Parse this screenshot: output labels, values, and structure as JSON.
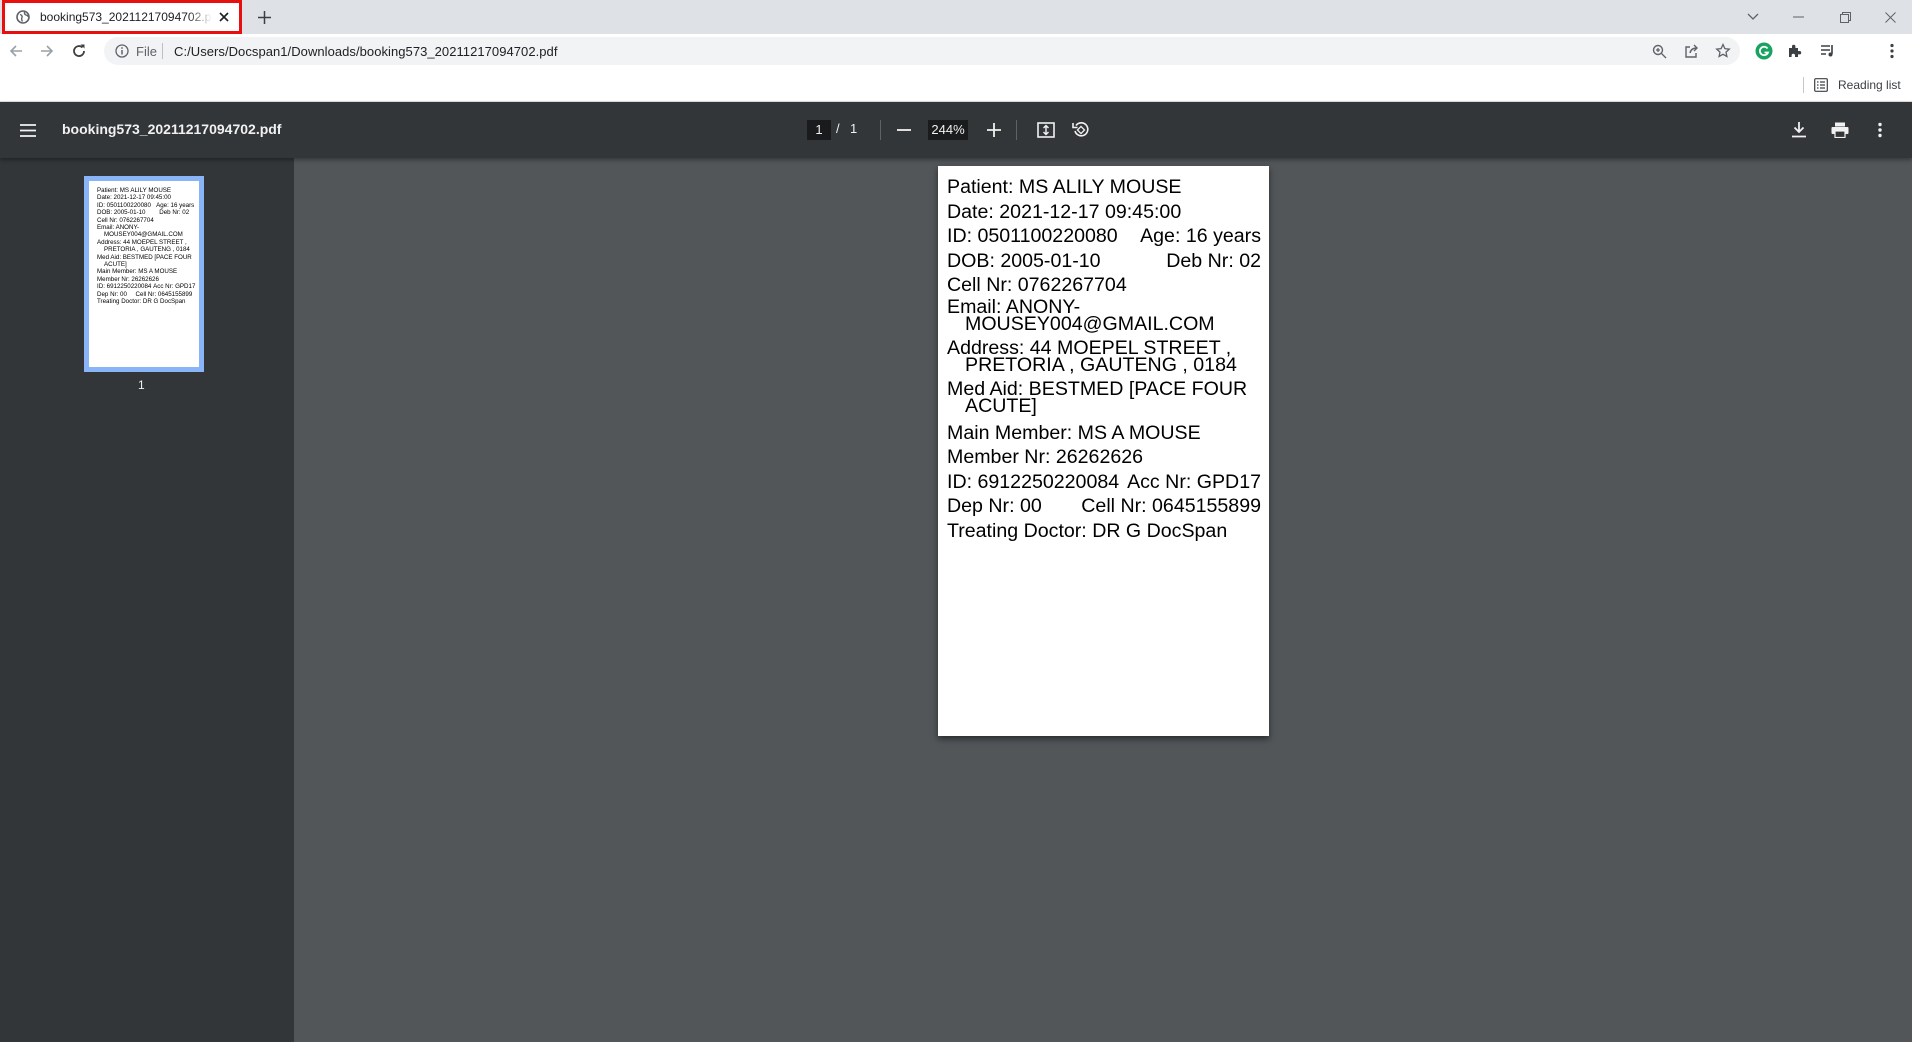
{
  "browser": {
    "tab_title": "booking573_20211217094702.pdf",
    "url_scheme": "File",
    "url": "C:/Users/Docspan1/Downloads/booking573_20211217094702.pdf",
    "reading_list_label": "Reading list",
    "extension_badge_color": "#1aa260",
    "tab_highlight_color": "#e8100f"
  },
  "pdf": {
    "file_name": "booking573_20211217094702.pdf",
    "current_page": "1",
    "page_separator": "/",
    "total_pages": "1",
    "zoom": "244%",
    "thumbnail_label": "1"
  },
  "document": {
    "patient": "Patient: MS ALILY MOUSE",
    "date": "Date: 2021-12-17 09:45:00",
    "id": "ID: 0501100220080",
    "age": "Age: 16 years",
    "dob": "DOB: 2005-01-10",
    "deb_nr": "Deb Nr: 02",
    "cell": "Cell Nr: 0762267704",
    "email_1": "Email: ANONY-",
    "email_2": "MOUSEY004@GMAIL.COM",
    "address_1": "Address: 44 MOEPEL STREET ,",
    "address_2": "PRETORIA , GAUTENG , 0184",
    "med_aid_1": "Med Aid: BESTMED [PACE FOUR",
    "med_aid_2": "ACUTE]",
    "main_member": "Main Member: MS A MOUSE",
    "member_nr": "Member Nr: 26262626",
    "member_id": "ID: 6912250220084",
    "acc_nr": "Acc Nr: GPD17",
    "dep_nr": "Dep Nr: 00",
    "member_cell": "Cell Nr: 0645155899",
    "doctor": "Treating Doctor: DR G DocSpan"
  }
}
